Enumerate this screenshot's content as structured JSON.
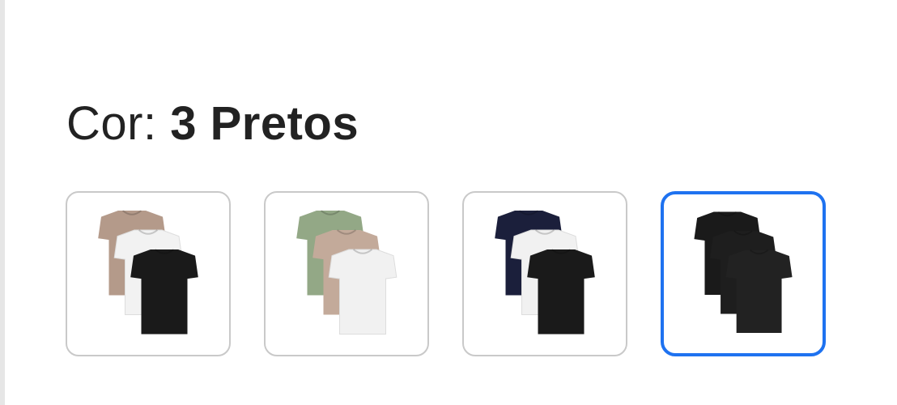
{
  "color_selector": {
    "label_prefix": "Cor:",
    "selected_value": "3 Pretos",
    "accent_color": "#1e72f0",
    "options": [
      {
        "icon": "tshirt-pack-beige-white-black-icon",
        "colors": [
          "#b49a8a",
          "#f2f2f2",
          "#1a1a1a"
        ],
        "selected": false
      },
      {
        "icon": "tshirt-pack-green-beige-white-icon",
        "colors": [
          "#93a886",
          "#c3aa9a",
          "#f1f1f1"
        ],
        "selected": false
      },
      {
        "icon": "tshirt-pack-navy-white-black-icon",
        "colors": [
          "#1b1f3b",
          "#f1f1f1",
          "#1a1a1a"
        ],
        "selected": false
      },
      {
        "icon": "tshirt-pack-black-icon",
        "colors": [
          "#1a1a1a",
          "#1e1e1e",
          "#222222"
        ],
        "selected": true
      }
    ]
  }
}
